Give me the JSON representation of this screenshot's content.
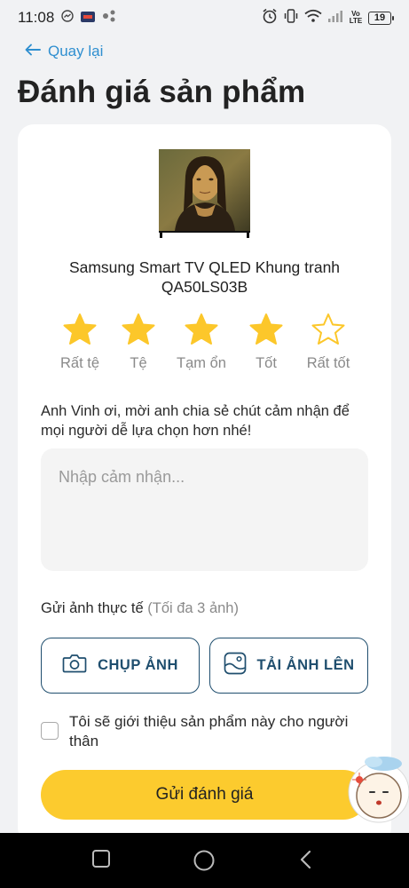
{
  "status_bar": {
    "time": "11:08",
    "battery": "19",
    "icons": [
      "messenger-icon",
      "app-icon",
      "share-icon",
      "alarm-icon",
      "vibrate-icon",
      "wifi-icon",
      "signal-icon",
      "volte-icon",
      "battery-icon"
    ],
    "volte_label": "Vo LTE"
  },
  "header": {
    "back_label": "Quay lại",
    "title": "Đánh giá sản phẩm"
  },
  "product": {
    "name": "Samsung Smart TV QLED Khung tranh QA50LS03B"
  },
  "rating": {
    "value": 4,
    "max": 5,
    "labels": [
      "Rất tệ",
      "Tệ",
      "Tạm ổn",
      "Tốt",
      "Rất tốt"
    ],
    "filled_color": "#fcc72a",
    "empty_color": "#fcc72a"
  },
  "feedback": {
    "prompt": "Anh Vinh ơi, mời anh chia sẻ chút cảm nhận để mọi người dễ lựa chọn hơn nhé!",
    "placeholder": "Nhập cảm nhận...",
    "value": ""
  },
  "photos": {
    "heading": "Gửi ảnh thực tế",
    "limit_note": "(Tối đa 3 ảnh)",
    "camera_label": "CHỤP ẢNH",
    "upload_label": "TẢI ẢNH LÊN"
  },
  "recommend": {
    "checked": false,
    "label": "Tôi sẽ giới thiệu sản phẩm này cho người thân"
  },
  "submit_label": "Gửi đánh giá",
  "colors": {
    "accent_link": "#2f8fd0",
    "primary_button": "#fccb2e",
    "outline_button": "#1f4e6e"
  }
}
